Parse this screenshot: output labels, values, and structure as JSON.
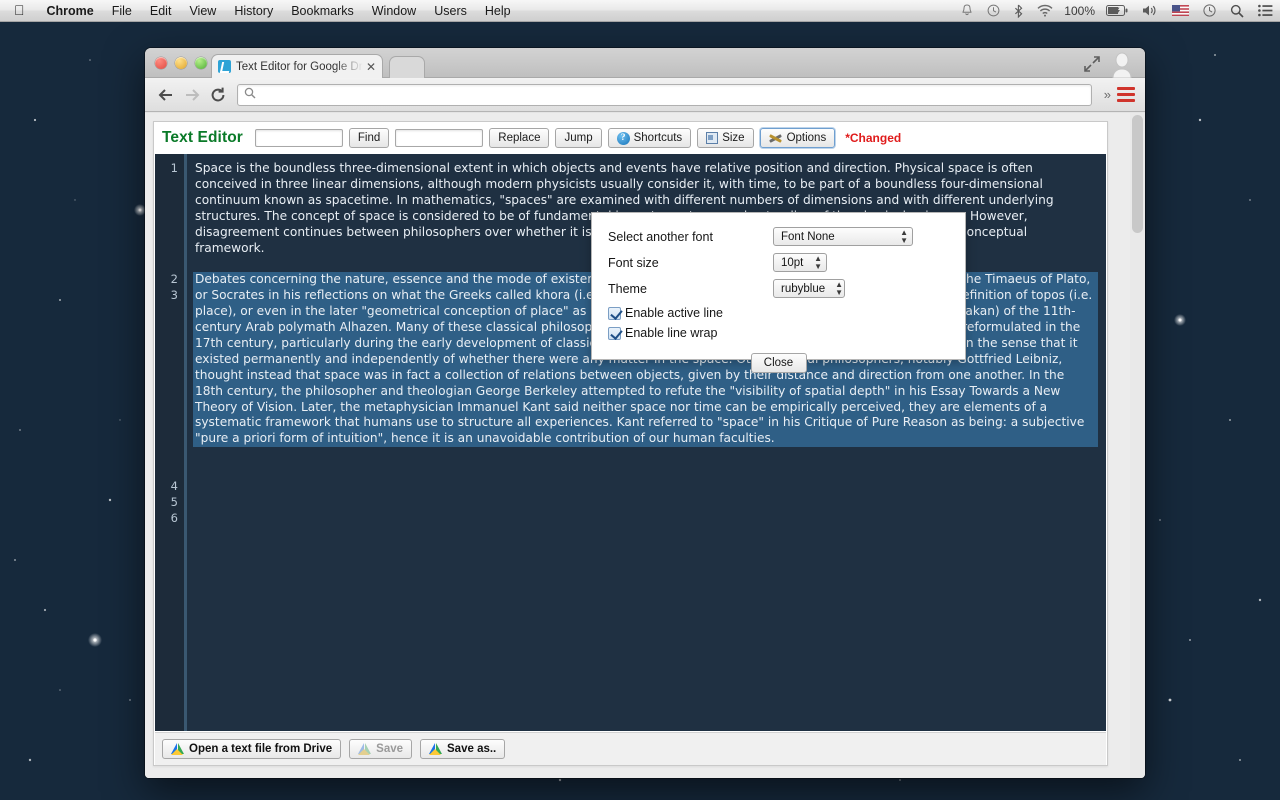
{
  "menubar": {
    "apple_icon": "apple-logo-icon",
    "items": [
      {
        "label": "Chrome",
        "bold": true
      },
      {
        "label": "File",
        "bold": false
      },
      {
        "label": "Edit",
        "bold": false
      },
      {
        "label": "View",
        "bold": false
      },
      {
        "label": "History",
        "bold": false
      },
      {
        "label": "Bookmarks",
        "bold": false
      },
      {
        "label": "Window",
        "bold": false
      },
      {
        "label": "Users",
        "bold": false
      },
      {
        "label": "Help",
        "bold": false
      }
    ],
    "status_items": [
      {
        "icon": "bell-icon",
        "glyph": "△"
      },
      {
        "icon": "time-machine-icon",
        "glyph": "◷"
      },
      {
        "icon": "bluetooth-icon",
        "glyph": "ᛦ"
      },
      {
        "icon": "wifi-icon",
        "glyph": "◠"
      },
      {
        "icon": "battery-percent-label",
        "label": "100%"
      },
      {
        "icon": "battery-icon",
        "glyph": "▭"
      },
      {
        "icon": "volume-icon",
        "glyph": "🔊"
      },
      {
        "icon": "keyboard-flag-icon",
        "glyph": "⚑"
      },
      {
        "icon": "clock-icon",
        "glyph": "◴"
      },
      {
        "icon": "spotlight-search-icon",
        "glyph": "⌕"
      },
      {
        "icon": "notification-center-icon",
        "glyph": "≡"
      }
    ]
  },
  "browser": {
    "tab": {
      "title": "Text Editor for Google Driv",
      "favicon": "text-editor-favicon",
      "close_icon": "close-icon"
    },
    "toolbar": {
      "back_icon": "back-arrow-icon",
      "forward_icon": "forward-arrow-icon",
      "reload_icon": "reload-icon",
      "omnibox_value": "",
      "omnibox_placeholder": "",
      "search_icon": "search-icon",
      "overflow_icon": "chevron-double-right-icon",
      "menu_icon": "hamburger-menu-icon",
      "fullscreen_icon": "fullscreen-icon",
      "avatar_icon": "user-avatar-icon"
    }
  },
  "app": {
    "title": "Text Editor",
    "find_value": "",
    "find_label": "Find",
    "replace_value": "",
    "replace_label": "Replace",
    "jump_label": "Jump",
    "shortcuts_label": "Shortcuts",
    "size_label": "Size",
    "options_label": "Options",
    "changed_label": "*Changed",
    "shortcuts_icon": "help-circle-icon",
    "size_icon": "window-size-icon",
    "options_icon": "tools-icon"
  },
  "editor": {
    "line_numbers": [
      "1",
      "2",
      "3",
      "4",
      "5",
      "6"
    ],
    "lines": [
      {
        "number": "1",
        "active": false,
        "text": "Space is the boundless three-dimensional extent in which objects and events have relative position and direction. Physical space is often conceived in three linear dimensions, although modern physicists usually consider it, with time, to be part of a boundless four-dimensional continuum known as spacetime. In mathematics, \"spaces\" are examined with different numbers of dimensions and with different underlying structures. The concept of space is considered to be of fundamental importance to an understanding of the physical universe. However, disagreement continues between philosophers over whether it is itself an entity, a relationship between entities, or part of a conceptual framework."
      },
      {
        "number": "2",
        "active": false,
        "text": ""
      },
      {
        "number": "3",
        "active": true,
        "text": "Debates concerning the nature, essence and the mode of existence of space date back to antiquity; namely, to treatises like the Timaeus of Plato, or Socrates in his reflections on what the Greeks called khora (i.e. \"space\"), or in the Physics of Aristotle (Book Delta) in the definition of topos (i.e. place), or even in the later \"geometrical conception of place\" as \"space qua extension\" in the Discourse on Place (Qawl fi al-Makan) of the 11th-century Arab polymath Alhazen. Many of these classical philosophical questions were discussed in the Renaissance and then reformulated in the 17th century, particularly during the early development of classical mechanics. In Isaac Newton's view, space was absolute—in the sense that it existed permanently and independently of whether there were any matter in the space. Other natural philosophers, notably Gottfried Leibniz, thought instead that space was in fact a collection of relations between objects, given by their distance and direction from one another. In the 18th century, the philosopher and theologian George Berkeley attempted to refute the \"visibility of spatial depth\" in his Essay Towards a New Theory of Vision. Later, the metaphysician Immanuel Kant said neither space nor time can be empirically perceived, they are elements of a systematic framework that humans use to structure all experiences. Kant referred to \"space\" in his Critique of Pure Reason as being: a subjective \"pure a priori form of intuition\", hence it is an unavoidable contribution of our human faculties."
      },
      {
        "number": "4",
        "active": false,
        "text": ""
      },
      {
        "number": "5",
        "active": false,
        "text": ""
      },
      {
        "number": "6",
        "active": false,
        "text": ""
      }
    ]
  },
  "options_dialog": {
    "font_label": "Select another font",
    "font_value": "Font None",
    "size_label": "Font size",
    "size_value": "10pt",
    "theme_label": "Theme",
    "theme_value": "rubyblue",
    "active_line_label": "Enable active line",
    "active_line_checked": true,
    "line_wrap_label": "Enable line wrap",
    "line_wrap_checked": true,
    "close_label": "Close"
  },
  "bottom_bar": {
    "open_label": "Open a text file from Drive",
    "save_label": "Save",
    "save_as_label": "Save as..",
    "drive_icon": "google-drive-icon"
  },
  "colors": {
    "app_title_green": "#0a7a28",
    "changed_red": "#e01b1b",
    "editor_bg": "#1f3042",
    "editor_active_line": "#2f5f86",
    "gutter_bg": "#1d2b3a",
    "menu_red": "#d0342c"
  }
}
